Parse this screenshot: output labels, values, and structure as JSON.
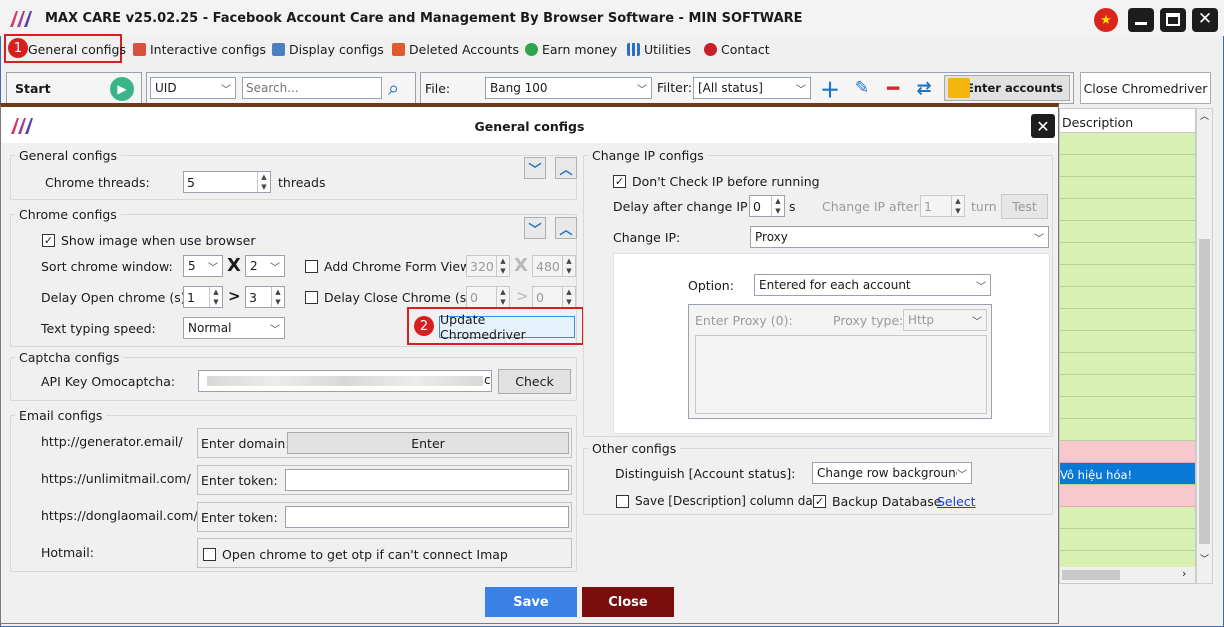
{
  "app": {
    "title": "MAX CARE v25.02.25 - Facebook Account Care and Management By Browser Software - MIN SOFTWARE"
  },
  "menu": [
    {
      "label": "General configs",
      "icon": "settings-icon"
    },
    {
      "label": "Interactive configs",
      "icon": "interactive-icon"
    },
    {
      "label": "Display configs",
      "icon": "display-icon"
    },
    {
      "label": "Deleted Accounts",
      "icon": "trash-icon"
    },
    {
      "label": "Earn money",
      "icon": "money-icon"
    },
    {
      "label": "Utilities",
      "icon": "grid-icon"
    },
    {
      "label": "Contact",
      "icon": "contact-icon"
    }
  ],
  "toolbar": {
    "start_label": "Start",
    "uid_select": "UID",
    "search_placeholder": "Search...",
    "file_label": "File:",
    "file_value": "Bang 100",
    "filter_label": "Filter:",
    "filter_value": "[All status]",
    "enter_accounts": "Enter accounts",
    "close_chromedriver": "Close Chromedriver"
  },
  "grid": {
    "header": "Description",
    "highlight_text": "Vô hiệu hóa!"
  },
  "dialog": {
    "title": "General configs",
    "general": {
      "section": "General configs",
      "threads_label": "Chrome threads:",
      "threads_value": "5",
      "threads_unit": "threads"
    },
    "chrome": {
      "section": "Chrome configs",
      "show_image": "Show image when use browser",
      "sort_label": "Sort chrome window:",
      "sort_cols": "5",
      "sort_x": "X",
      "sort_rows": "2",
      "add_form_view": "Add Chrome Form View",
      "form_w": "320",
      "form_h": "480",
      "delay_open_label": "Delay Open chrome (s):",
      "delay_open_from": "1",
      "delay_open_to": "3",
      "gt": ">",
      "delay_close_label": "Delay Close Chrome (s):",
      "delay_close_from": "0",
      "delay_close_to": "0",
      "typing_label": "Text typing speed:",
      "typing_value": "Normal",
      "update_btn": "Update Chromedriver"
    },
    "captcha": {
      "section": "Captcha configs",
      "api_label": "API Key Omocaptcha:",
      "api_tail": "c",
      "check_btn": "Check"
    },
    "email": {
      "section": "Email configs",
      "generator": "http://generator.email/",
      "enter_domain": "Enter domain:",
      "enter_btn": "Enter",
      "unlimit": "https://unlimitmail.com/",
      "enter_token": "Enter token:",
      "donglao": "https://donglaomail.com/",
      "enter_token2": "Enter token:",
      "hotmail": "Hotmail:",
      "open_chrome_otp": "Open chrome to get otp if can't connect Imap"
    },
    "ip": {
      "section": "Change IP configs",
      "dont_check": "Don't Check IP before running",
      "delay_label": "Delay after change IP:",
      "delay_value": "0",
      "delay_unit": "s",
      "change_after_label": "Change IP after:",
      "change_after_value": "1",
      "turn": "turn",
      "test_btn": "Test",
      "change_ip_label": "Change IP:",
      "change_ip_value": "Proxy",
      "option_label": "Option:",
      "option_value": "Entered for each account",
      "enter_proxy": "Enter Proxy (0):",
      "proxy_type_label": "Proxy type:",
      "proxy_type_value": "Http"
    },
    "other": {
      "section": "Other configs",
      "distinguish_label": "Distinguish [Account status]:",
      "distinguish_value": "Change row background",
      "save_desc": "Save [Description] column data",
      "backup": "Backup Database",
      "select_link": "Select"
    },
    "save_btn": "Save",
    "close_btn": "Close"
  },
  "annotations": {
    "step1": "1",
    "step2": "2"
  },
  "colors": {
    "accent_blue": "#1f73c8",
    "save_blue": "#3b82e6",
    "close_maroon": "#7b0d0d",
    "grid_green": "#d9f0b3",
    "grid_pink": "#f8c8cf",
    "grid_selected": "#0a78d7",
    "annotation_red": "#d62020"
  }
}
